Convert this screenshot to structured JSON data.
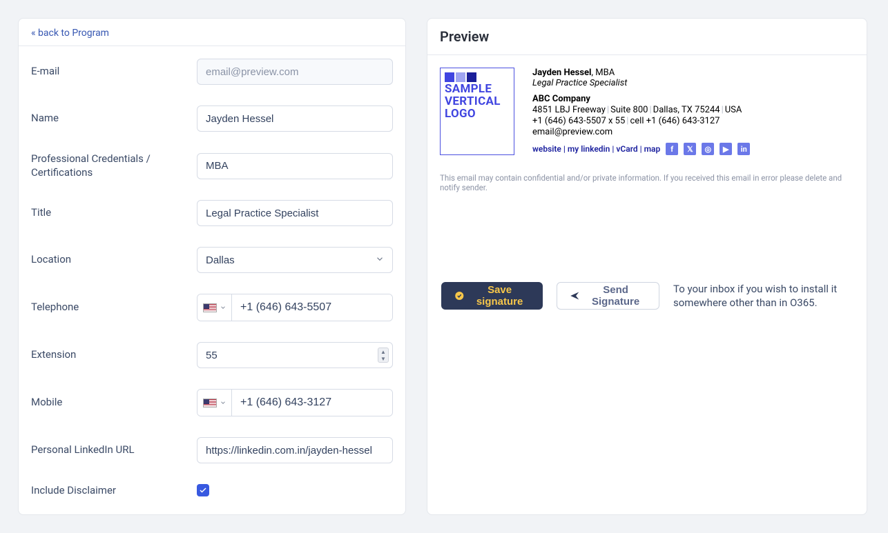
{
  "form": {
    "back_link": "« back to Program",
    "labels": {
      "email": "E-mail",
      "name": "Name",
      "credentials": "Professional Credentials / Certifications",
      "title": "Title",
      "location": "Location",
      "telephone": "Telephone",
      "extension": "Extension",
      "mobile": "Mobile",
      "linkedin": "Personal LinkedIn URL",
      "disclaimer": "Include Disclaimer"
    },
    "values": {
      "email": "email@preview.com",
      "name": "Jayden Hessel",
      "credentials": "MBA",
      "title": "Legal Practice Specialist",
      "location": "Dallas",
      "telephone": "+1 (646) 643-5507",
      "extension": "55",
      "mobile": "+1 (646) 643-3127",
      "linkedin": "https://linkedin.com.in/jayden-hessel",
      "include_disclaimer": true
    }
  },
  "preview": {
    "heading": "Preview",
    "logo": {
      "line1": "SAMPLE",
      "line2": "VERTICAL",
      "line3": "LOGO"
    },
    "signature": {
      "name": "Jayden Hessel",
      "credentials_suffix": ", MBA",
      "title": "Legal Practice Specialist",
      "company": "ABC Company",
      "addr_street": "4851 LBJ Freeway",
      "addr_suite": "Suite 800",
      "addr_city": "Dallas, TX 75244",
      "addr_country": "USA",
      "phone": "+1 (646) 643-5507 x 55",
      "cell_label": "cell ",
      "cell": "+1 (646) 643-3127",
      "email": "email@preview.com",
      "links": {
        "website": "website",
        "linkedin": "my linkedin",
        "vcard": "vCard",
        "map": "map"
      }
    },
    "disclaimer_text": "This email may contain confidential and/or private information. If you received this email in error please delete and notify sender.",
    "actions": {
      "save": "Save signature",
      "send": "Send Signature",
      "note": "To your inbox if you wish to install it somewhere other than in O365."
    }
  }
}
